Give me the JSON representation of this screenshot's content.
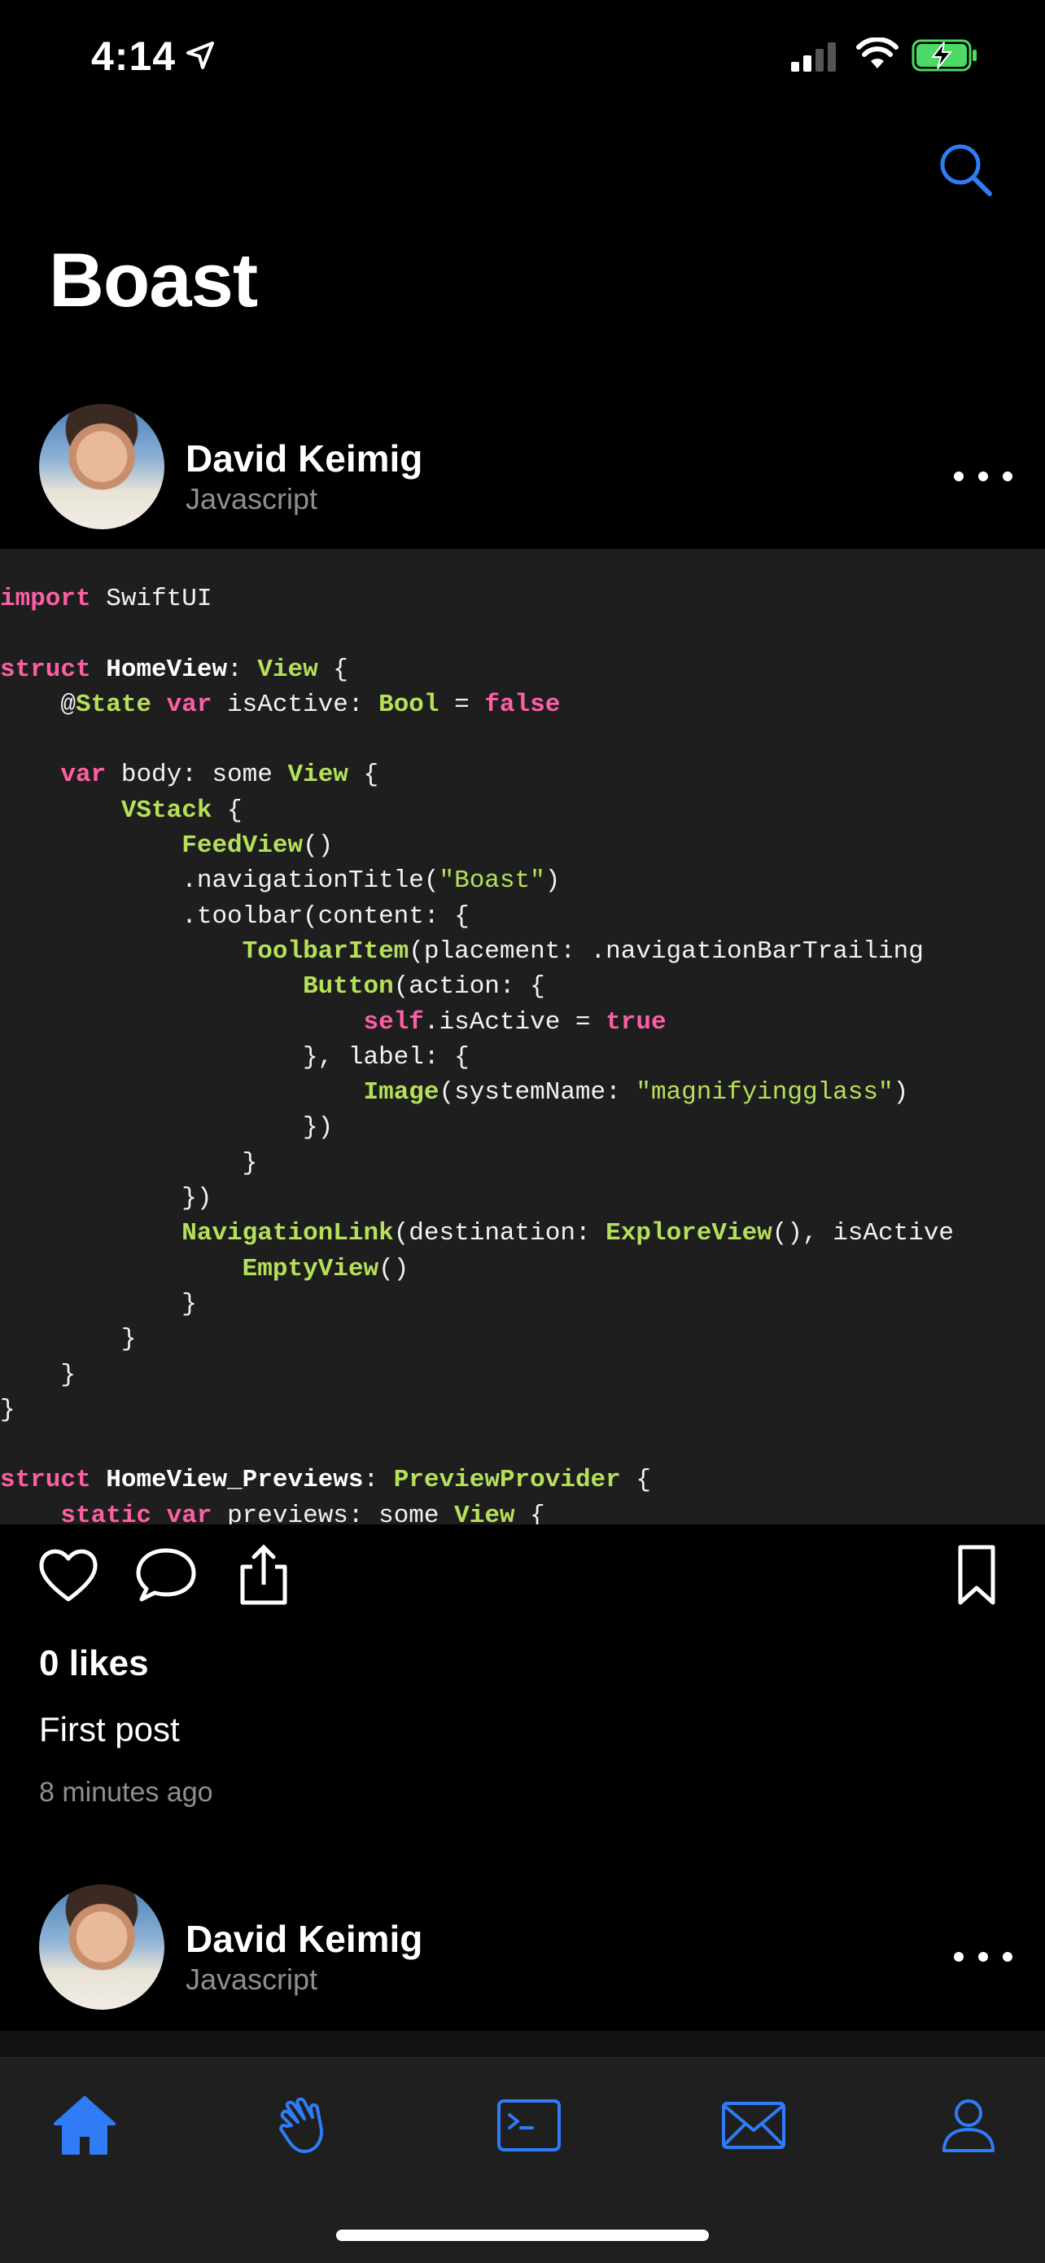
{
  "status_bar": {
    "time": "4:14"
  },
  "nav": {
    "title": "Boast",
    "search_icon": "magnifyingglass-icon"
  },
  "posts": [
    {
      "author": "David Keimig",
      "language": "Javascript"
    },
    {
      "author": "David Keimig",
      "language": "Javascript"
    }
  ],
  "post": {
    "likes": "0 likes",
    "caption": "First post",
    "time_ago": "8 minutes ago"
  },
  "code": {
    "lines": [
      "import SwiftUI",
      "",
      "struct HomeView: View {",
      "    @State var isActive: Bool = false",
      "",
      "    var body: some View {",
      "        VStack {",
      "            FeedView()",
      "            .navigationTitle(\"Boast\")",
      "            .toolbar(content: {",
      "                ToolbarItem(placement: .navigationBarTrailing",
      "                    Button(action: {",
      "                        self.isActive = true",
      "                    }, label: {",
      "                        Image(systemName: \"magnifyingglass\")",
      "                    })",
      "                }",
      "            })",
      "            NavigationLink(destination: ExploreView(), isActive",
      "                EmptyView()",
      "            }",
      "        }",
      "    }",
      "}",
      "",
      "struct HomeView_Previews: PreviewProvider {",
      "    static var previews: some View {"
    ]
  },
  "tabbar": {
    "items": [
      "home-icon",
      "hand-wave-icon",
      "terminal-icon",
      "envelope-icon",
      "person-icon"
    ],
    "active": "home-icon"
  },
  "colors": {
    "accent": "#2f7cf6",
    "keyword": "#fc5fa3",
    "type": "#b5e05a",
    "code_bg": "#1e1e1e"
  }
}
